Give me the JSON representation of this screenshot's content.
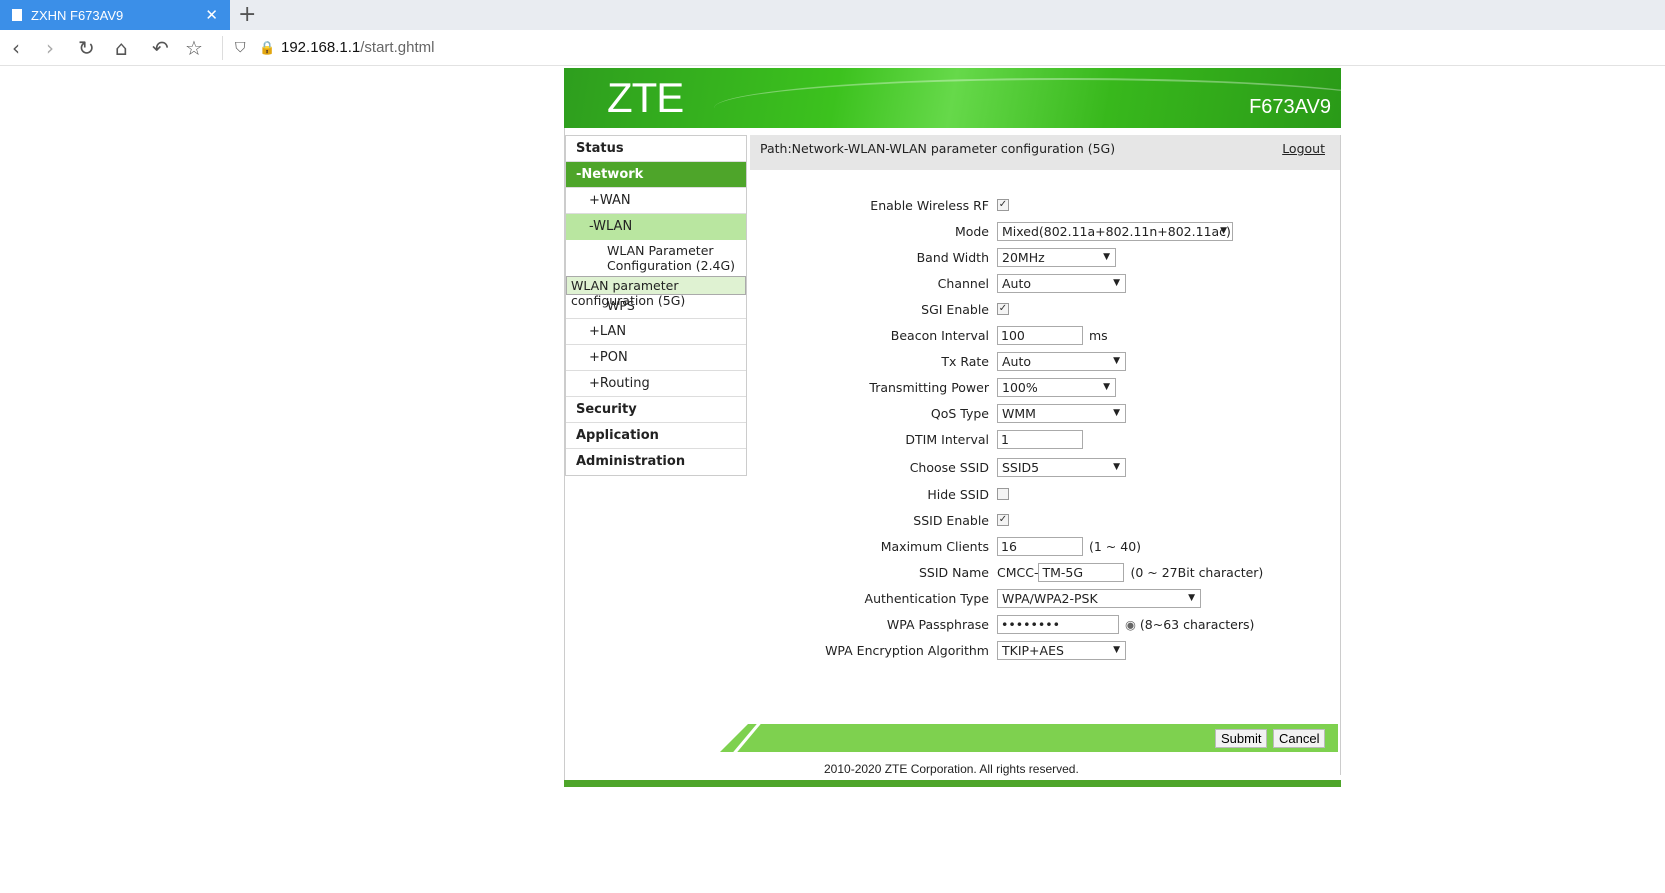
{
  "browser": {
    "tab_title": "ZXHN F673AV9",
    "url_host": "192.168.1.1",
    "url_path": "/start.ghtml"
  },
  "banner": {
    "logo": "ZTE",
    "model": "F673AV9"
  },
  "sidebar": {
    "status": "Status",
    "network": "-Network",
    "wan": "+WAN",
    "wlan": "-WLAN",
    "wlan24": "WLAN Parameter Configuration (2.4G)",
    "wlan5": "WLAN parameter configuration (5G)",
    "wps": "WPS",
    "lan": "+LAN",
    "pon": "+PON",
    "routing": "+Routing",
    "security": "Security",
    "application": "Application",
    "administration": "Administration"
  },
  "header": {
    "path": "Path:Network-WLAN-WLAN parameter configuration (5G)",
    "logout": "Logout"
  },
  "form": {
    "enable_rf": {
      "label": "Enable Wireless RF",
      "checked": true
    },
    "mode": {
      "label": "Mode",
      "value": "Mixed(802.11a+802.11n+802.11ac)"
    },
    "band_width": {
      "label": "Band Width",
      "value": "20MHz"
    },
    "channel": {
      "label": "Channel",
      "value": "Auto"
    },
    "sgi": {
      "label": "SGI Enable",
      "checked": true
    },
    "beacon": {
      "label": "Beacon Interval",
      "value": "100",
      "unit": "ms"
    },
    "tx_rate": {
      "label": "Tx Rate",
      "value": "Auto"
    },
    "tx_power": {
      "label": "Transmitting Power",
      "value": "100%"
    },
    "qos": {
      "label": "QoS Type",
      "value": "WMM"
    },
    "dtim": {
      "label": "DTIM Interval",
      "value": "1"
    },
    "choose_ssid": {
      "label": "Choose SSID",
      "value": "SSID5"
    },
    "hide_ssid": {
      "label": "Hide SSID",
      "checked": false
    },
    "ssid_enable": {
      "label": "SSID Enable",
      "checked": true
    },
    "max_clients": {
      "label": "Maximum Clients",
      "value": "16",
      "hint": "(1 ~ 40)"
    },
    "ssid_name": {
      "label": "SSID Name",
      "prefix": "CMCC-",
      "value": "TM-5G",
      "hint": "(0 ~ 27Bit character)"
    },
    "auth": {
      "label": "Authentication Type",
      "value": "WPA/WPA2-PSK"
    },
    "passphrase": {
      "label": "WPA Passphrase",
      "value": "••••••••",
      "hint": "(8~63 characters)"
    },
    "encryption": {
      "label": "WPA Encryption Algorithm",
      "value": "TKIP+AES"
    }
  },
  "buttons": {
    "submit": "Submit",
    "cancel": "Cancel"
  },
  "footer": {
    "copyright": "2010-2020 ZTE Corporation. All rights reserved."
  }
}
